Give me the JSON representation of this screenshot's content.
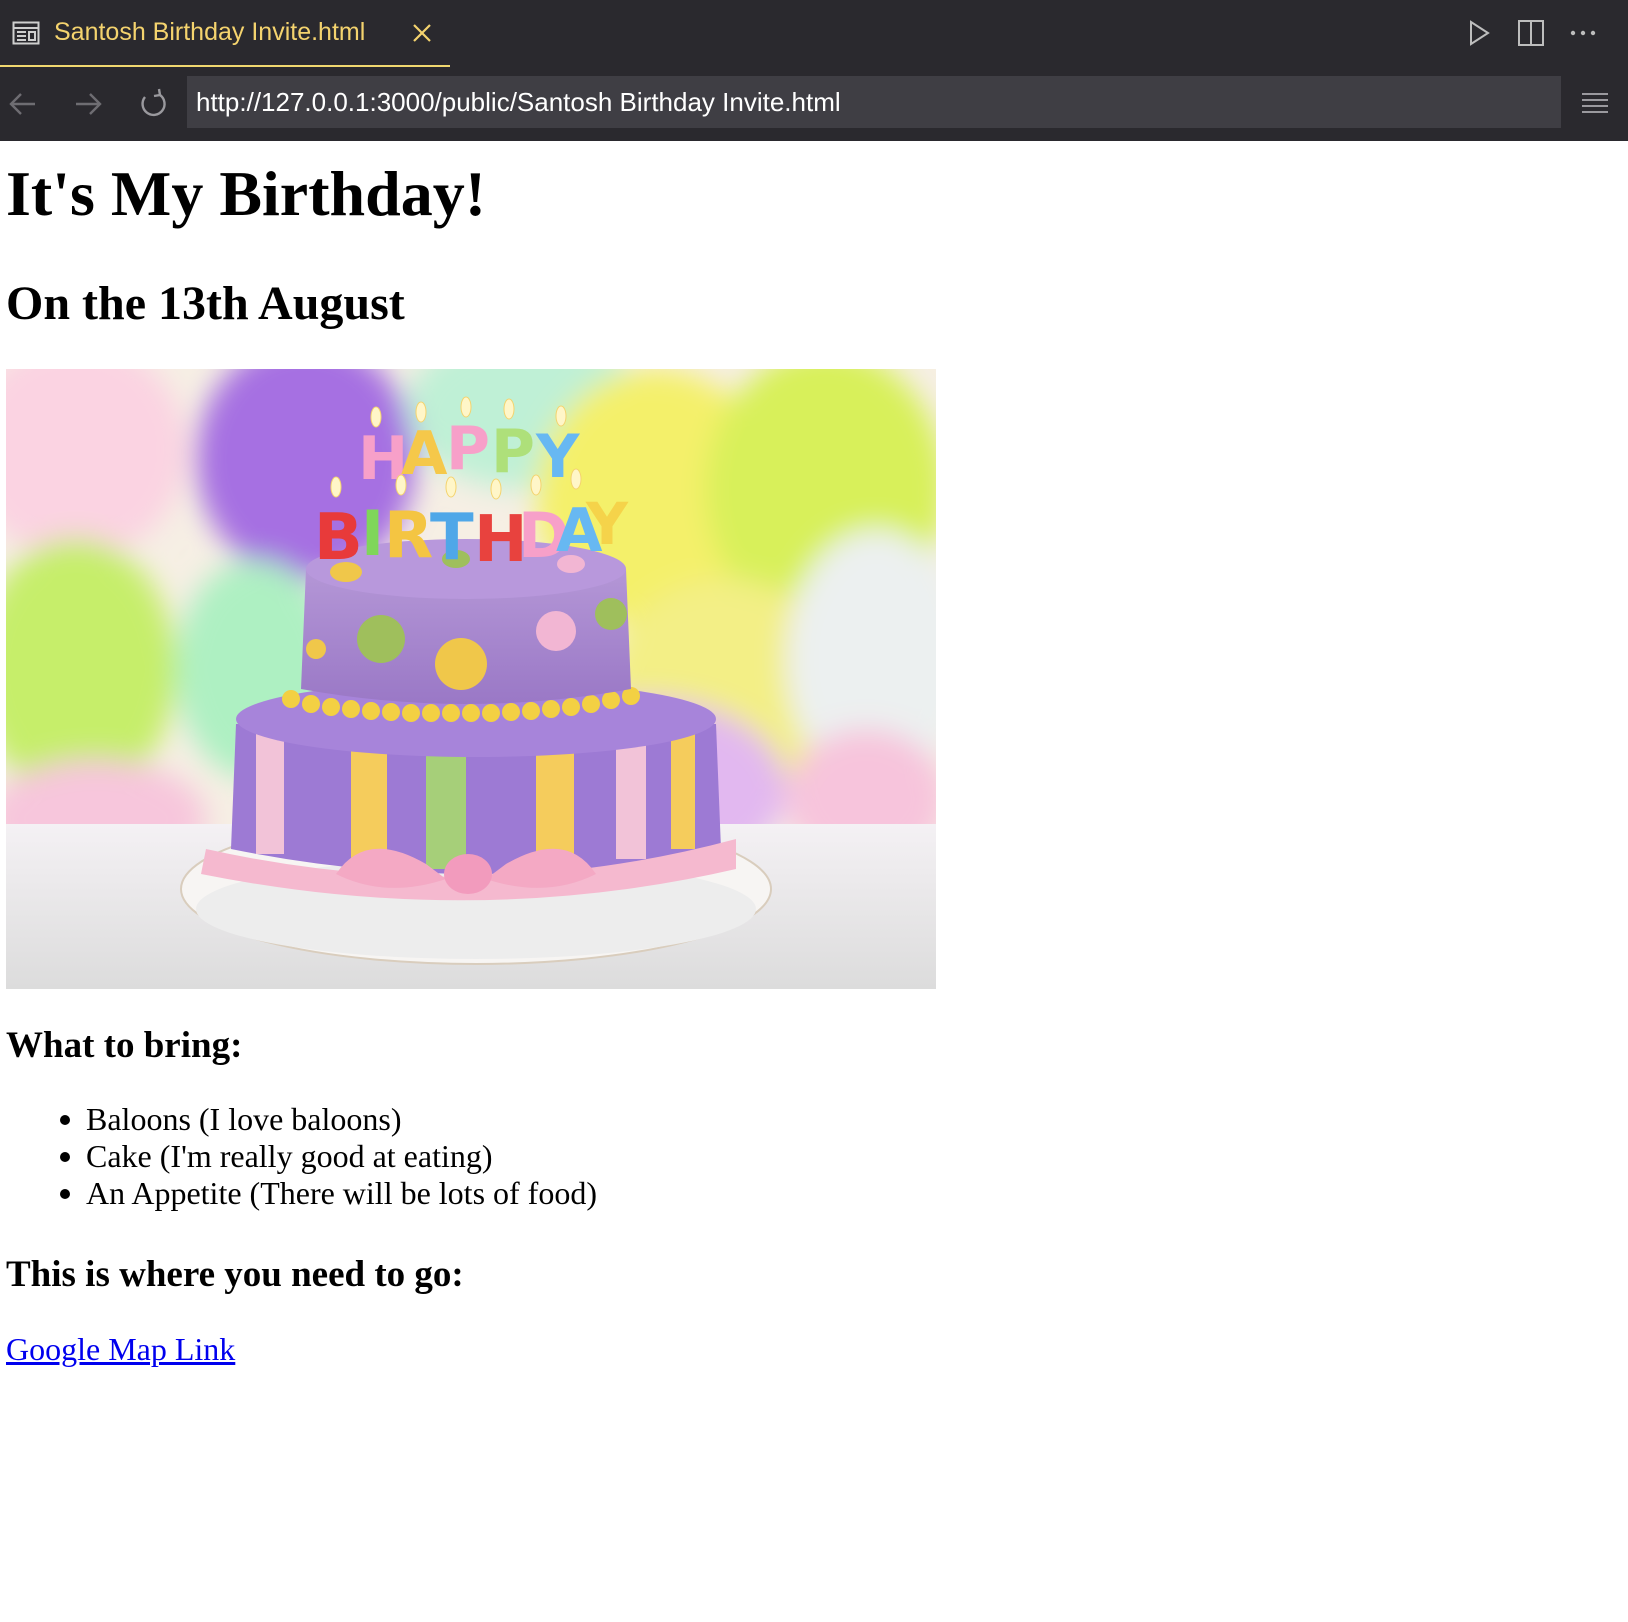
{
  "editor": {
    "tab": {
      "title": "Santosh Birthday Invite.html",
      "icon": "preview-icon",
      "active_color": "#f4d36e"
    },
    "actions": [
      "run-icon",
      "split-editor-icon",
      "more-actions-icon"
    ]
  },
  "browser": {
    "url": "http://127.0.0.1:3000/public/Santosh Birthday Invite.html",
    "nav_icons": [
      "back-arrow-icon",
      "forward-arrow-icon",
      "reload-icon",
      "menu-icon"
    ]
  },
  "page": {
    "title": "It's My Birthday!",
    "subtitle": "On the 13th August",
    "image": {
      "alt": "HAPPY BIRTHDAY",
      "candle_letters": [
        "H",
        "A",
        "P",
        "P",
        "Y",
        "B",
        "I",
        "R",
        "T",
        "H",
        "D",
        "A",
        "Y"
      ]
    },
    "bring_heading": "What to bring:",
    "bring_items": [
      "Baloons (I love baloons)",
      "Cake (I'm really good at eating)",
      "An Appetite (There will be lots of food)"
    ],
    "location_heading": "This is where you need to go:",
    "map_link_label": "Google Map Link",
    "link_color": "#0000ee"
  }
}
